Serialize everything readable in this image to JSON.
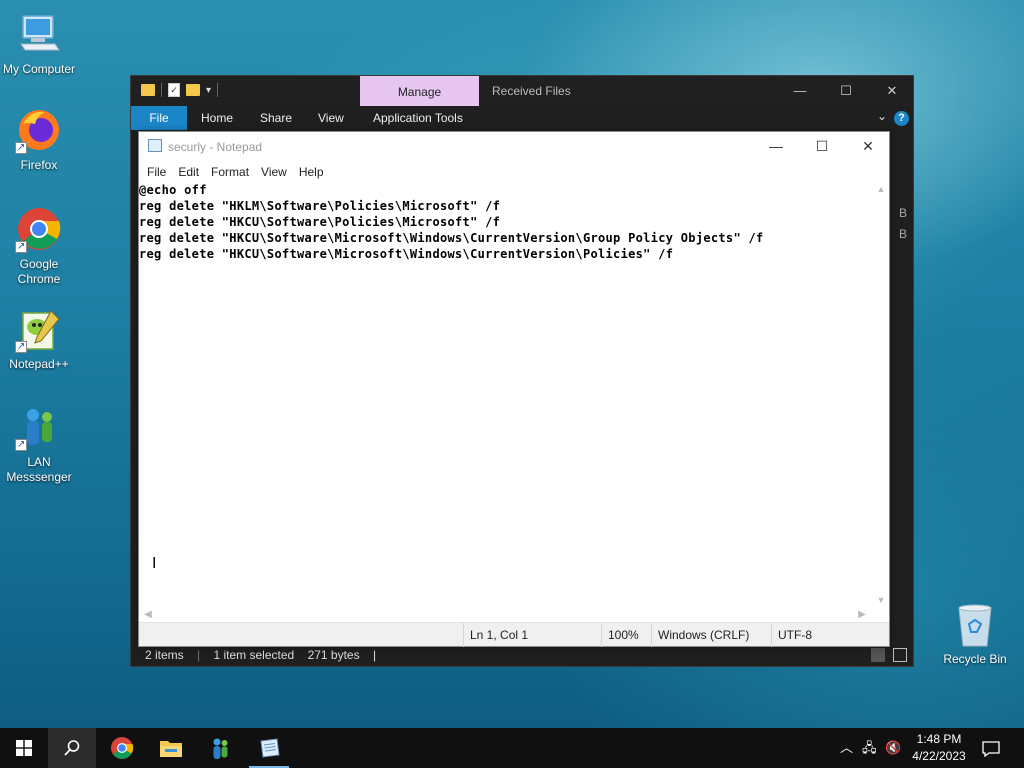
{
  "desktop": {
    "icons": [
      {
        "label": "My Computer"
      },
      {
        "label": "Firefox"
      },
      {
        "label": "Google Chrome"
      },
      {
        "label": "Notepad++"
      },
      {
        "label": "LAN Messsenger"
      },
      {
        "label": "Recycle Bin"
      }
    ]
  },
  "explorer": {
    "manage_tab": "Manage",
    "title": "Received Files",
    "ribbon_tabs": [
      "File",
      "Home",
      "Share",
      "View",
      "Application Tools"
    ],
    "help": "?",
    "side_letters": [
      "B",
      "B"
    ],
    "status": {
      "items": "2 items",
      "selected": "1 item selected",
      "size": "271 bytes",
      "sep": "|"
    }
  },
  "notepad": {
    "title": "securly - Notepad",
    "menu": [
      "File",
      "Edit",
      "Format",
      "View",
      "Help"
    ],
    "lines": [
      "@echo off",
      "reg delete \"HKLM\\Software\\Policies\\Microsoft\" /f",
      "reg delete \"HKCU\\Software\\Policies\\Microsoft\" /f",
      "reg delete \"HKCU\\Software\\Microsoft\\Windows\\CurrentVersion\\Group Policy Objects\" /f",
      "reg delete \"HKCU\\Software\\Microsoft\\Windows\\CurrentVersion\\Policies\" /f"
    ],
    "status": {
      "position": "Ln 1, Col 1",
      "zoom": "100%",
      "line_ending": "Windows (CRLF)",
      "encoding": "UTF-8"
    }
  },
  "taskbar": {
    "time": "1:48 PM",
    "date": "4/22/2023"
  },
  "colors": {
    "manage_tab": "#e7c7f2",
    "file_tab": "#1a86c8",
    "taskbar": "#101010"
  }
}
